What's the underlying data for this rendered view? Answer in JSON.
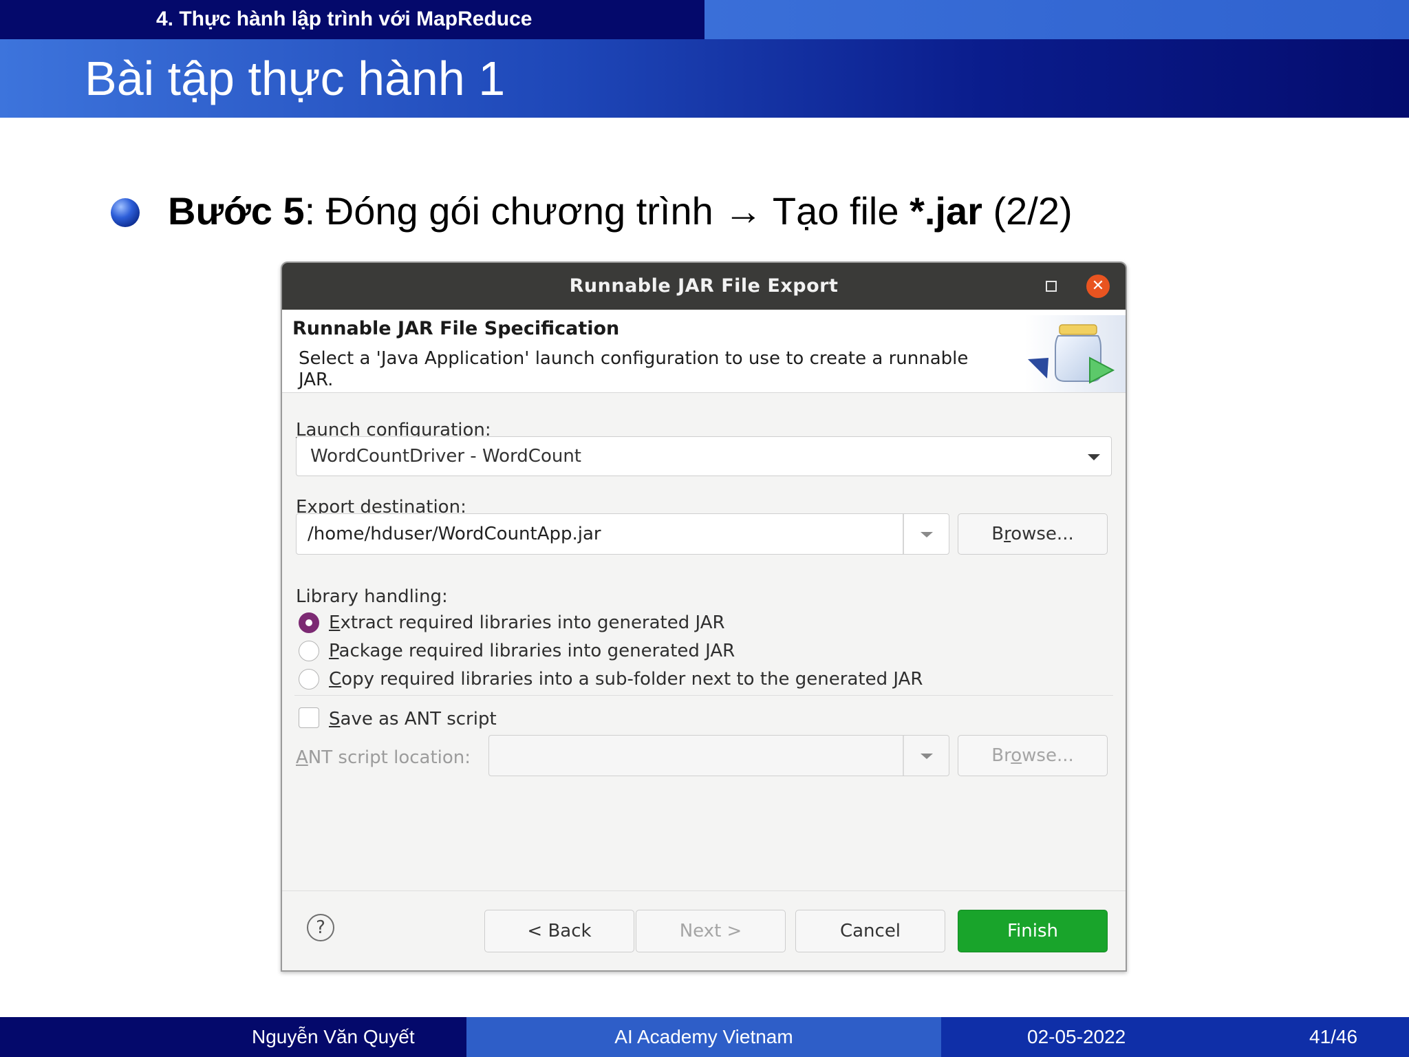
{
  "slide": {
    "section": "4. Thực hành lập trình với MapReduce",
    "title": "Bài tập thực hành 1",
    "bullet": {
      "bold_prefix": "Bước 5",
      "text": ": Đóng gói chương trình ",
      "arrow": "→",
      "text2": " Tạo file ",
      "bold_file": "*.jar",
      "suffix": " (2/2)"
    }
  },
  "dialog": {
    "title": "Runnable JAR File Export",
    "spec_title": "Runnable JAR File Specification",
    "spec_desc": "Select a 'Java Application' launch configuration to use to create a runnable JAR.",
    "launch_label_first": "L",
    "launch_label_rest": "aunch configuration:",
    "launch_value": "WordCountDriver - WordCount",
    "export_label_a": "Export ",
    "export_label_u": "d",
    "export_label_b": "estination:",
    "export_value": "/home/hduser/WordCountApp.jar",
    "browse_a": "B",
    "browse_u": "r",
    "browse_b": "owse...",
    "library_label": "Library handling:",
    "options": [
      {
        "u": "E",
        "rest": "xtract required libraries into generated JAR",
        "checked": true
      },
      {
        "u": "P",
        "rest": "ackage required libraries into generated JAR",
        "checked": false
      },
      {
        "u": "C",
        "rest": "opy required libraries into a sub-folder next to the generated JAR",
        "checked": false
      }
    ],
    "save_ant_u": "S",
    "save_ant_rest": "ave as ANT script",
    "ant_label_u": "A",
    "ant_label_rest": "NT script location:",
    "ant_value": "",
    "browse2_a": "Br",
    "browse2_u": "o",
    "browse2_b": "wse...",
    "back": "< Back",
    "next": "Next >",
    "cancel": "Cancel",
    "finish": "Finish",
    "help": "?"
  },
  "footer": {
    "author": "Nguyễn Văn Quyết",
    "org": "AI Academy Vietnam",
    "date": "02-05-2022",
    "page": "41/46"
  },
  "colors": {
    "header_dark": "#04096b",
    "header_light": "#3a6fd8",
    "finish_green": "#19a42b",
    "close_orange": "#e95420",
    "radio_purple": "#7c2a73"
  },
  "icons": {
    "bullet": "sphere-bullet-icon",
    "close": "close-icon",
    "maximize": "maximize-icon",
    "jar": "jar-export-icon",
    "help": "help-icon",
    "dropdown": "chevron-down-icon"
  }
}
